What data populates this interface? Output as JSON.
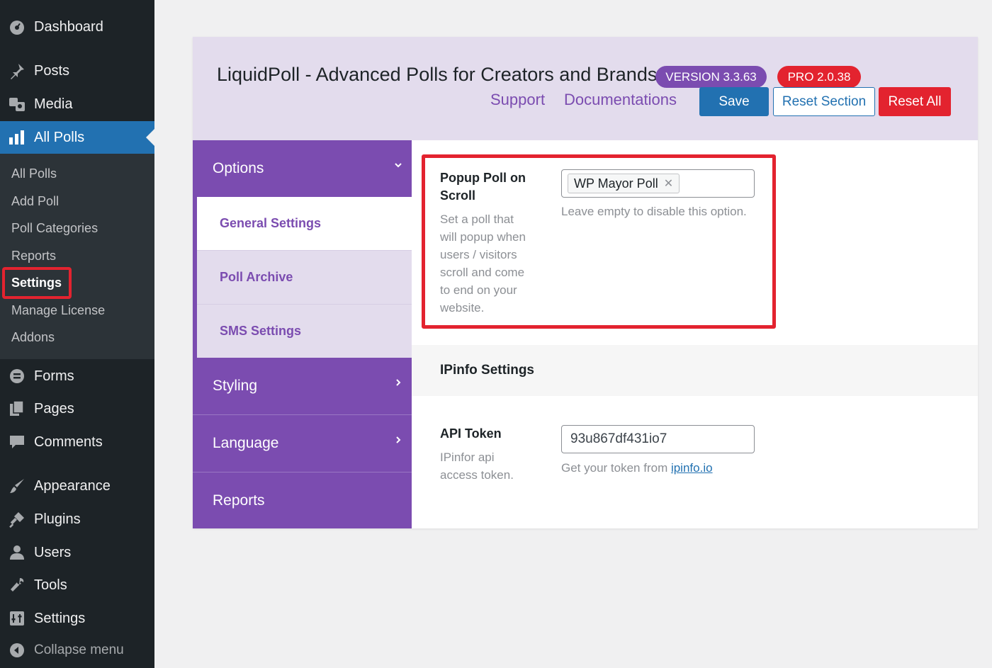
{
  "sidebar": {
    "top_items": [
      {
        "label": "Dashboard",
        "icon": "dashboard-icon"
      },
      {
        "label": "Posts",
        "icon": "pin-icon"
      },
      {
        "label": "Media",
        "icon": "media-icon"
      },
      {
        "label": "All Polls",
        "icon": "bar-chart-icon"
      }
    ],
    "submenu": [
      "All Polls",
      "Add Poll",
      "Poll Categories",
      "Reports",
      "Settings",
      "Manage License",
      "Addons"
    ],
    "bottom_items": [
      {
        "label": "Forms",
        "icon": "forms-icon"
      },
      {
        "label": "Pages",
        "icon": "pages-icon"
      },
      {
        "label": "Comments",
        "icon": "comment-icon"
      },
      {
        "label": "Appearance",
        "icon": "brush-icon"
      },
      {
        "label": "Plugins",
        "icon": "plugin-icon"
      },
      {
        "label": "Users",
        "icon": "user-icon"
      },
      {
        "label": "Tools",
        "icon": "wrench-icon"
      },
      {
        "label": "Settings",
        "icon": "settings-icon"
      }
    ],
    "collapse_label": "Collapse menu"
  },
  "header": {
    "title": "LiquidPoll - Advanced Polls for Creators and Brands",
    "version_badge": "VERSION 3.3.63",
    "pro_badge": "PRO 2.0.38",
    "support_link": "Support",
    "docs_link": "Documentations",
    "save_label": "Save",
    "reset_section_label": "Reset Section",
    "reset_all_label": "Reset All"
  },
  "nav": {
    "options": "Options",
    "general_settings": "General Settings",
    "poll_archive": "Poll Archive",
    "sms_settings": "SMS Settings",
    "styling": "Styling",
    "language": "Language",
    "reports": "Reports"
  },
  "content": {
    "popup": {
      "label_line1": "Popup Poll on",
      "label_line2": "Scroll",
      "desc": [
        "Set a poll that",
        "will popup when",
        "users / visitors",
        "scroll and come",
        "to end on your",
        "website."
      ],
      "tag": "WP Mayor Poll",
      "help": "Leave empty to disable this option."
    },
    "ipinfo": {
      "section_title": "IPinfo Settings",
      "label": "API Token",
      "desc": [
        "IPinfor api",
        "access token."
      ],
      "value": "93u867df431io7",
      "help_prefix": "Get your token from ",
      "help_link": "ipinfo.io"
    }
  },
  "colors": {
    "sidebar": "#1d2327",
    "active": "#2271b1",
    "purple": "#7b4cb0",
    "red": "#e3232f",
    "lavender": "#e3dced"
  }
}
